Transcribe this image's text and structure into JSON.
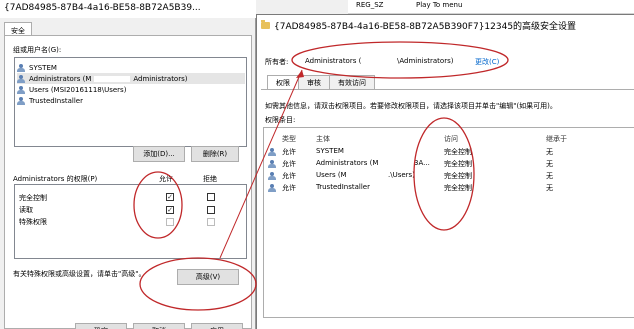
{
  "registry": {
    "type": "REG_SZ",
    "value": "Play To menu"
  },
  "props": {
    "title": "{7AD84985-87B4-4a16-BE58-8B72A5B39...",
    "tab": "安全",
    "group_label": "组或用户名(G):",
    "users": [
      "SYSTEM",
      "Administrators (M",
      "Administrators)",
      "Users (MSI20161118\\Users)",
      "TrustedInstaller"
    ],
    "add_button": "添加(D)...",
    "remove_button": "删除(R)",
    "perm_label": "Administrators 的权限(P)",
    "allow_header": "允许",
    "deny_header": "拒绝",
    "permissions": [
      {
        "name": "完全控制",
        "allow": "✓",
        "deny": ""
      },
      {
        "name": "读取",
        "allow": "✓",
        "deny": ""
      },
      {
        "name": "特殊权限",
        "allow": "",
        "deny": ""
      }
    ],
    "advanced_hint": "有关特殊权限或高级设置，请单击\"高级\"。",
    "advanced_button": "高级(V)",
    "ok_button": "确定",
    "cancel_button": "取消",
    "apply_button": "应用"
  },
  "advanced": {
    "title": "{7AD84985-87B4-4a16-BE58-8B72A5B390F7}12345的高级安全设置",
    "owner_label": "所有者:",
    "owner_value_a": "Administrators (",
    "owner_value_b": "\\Administrators)",
    "change_link": "更改(C)",
    "tabs": [
      "权限",
      "审核",
      "有效访问"
    ],
    "info": "如需其他信息，请双击权限项目。若要修改权限项目，请选择该项目并单击\"编辑\"(如果可用)。",
    "entries_label": "权限条目:",
    "headers": {
      "type": "类型",
      "principal": "主体",
      "access": "访问",
      "inherit": "继承于"
    },
    "rows": [
      {
        "type": "允许",
        "principal": "SYSTEM",
        "principal_suffix": "",
        "access": "完全控制",
        "inherit": "无"
      },
      {
        "type": "允许",
        "principal": "Administrators (M",
        "principal_suffix": "3A...",
        "access": "完全控制",
        "inherit": "无"
      },
      {
        "type": "允许",
        "principal": "Users (M",
        "principal_suffix": ".\\Users)",
        "access": "完全控制",
        "inherit": "无"
      },
      {
        "type": "允许",
        "principal": "TrustedInstaller",
        "principal_suffix": "",
        "access": "完全控制",
        "inherit": "无"
      }
    ]
  },
  "colors": {
    "annotation": "#c0282a",
    "link": "#0066cc"
  }
}
